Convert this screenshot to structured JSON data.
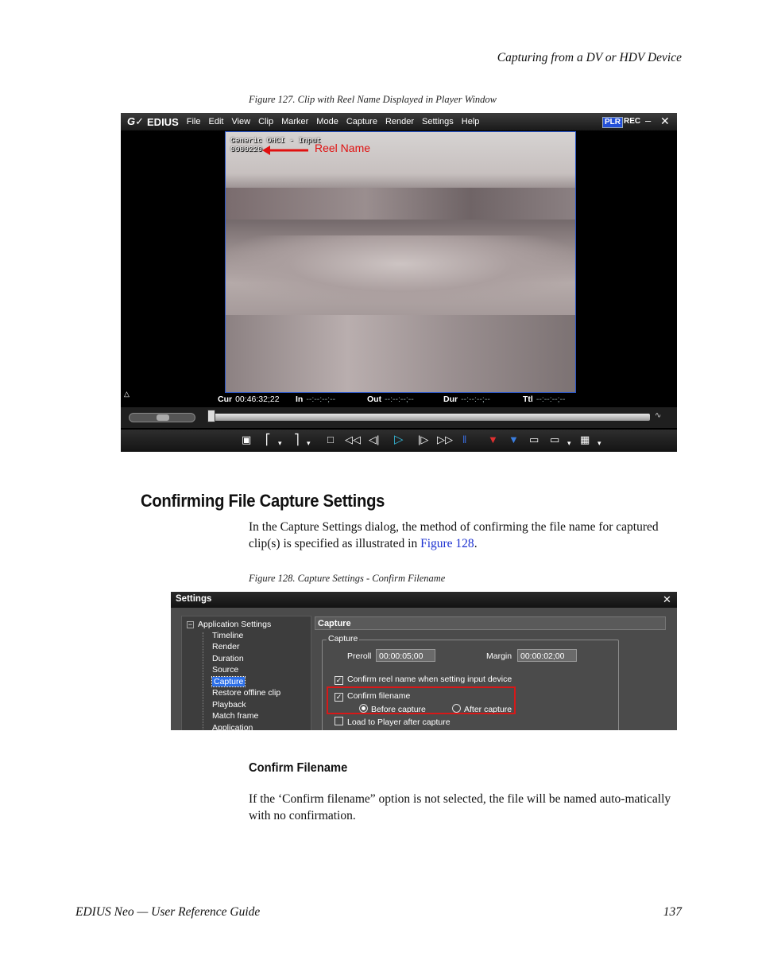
{
  "page": {
    "running_head": "Capturing from a DV or HDV Device",
    "section_title": "Confirming File Capture Settings",
    "intro_before_link": "In the Capture Settings dialog, the method of confirming the file name for captured clip(s) is specified as illustrated in ",
    "intro_link": "Figure 128",
    "intro_after_link": ".",
    "subsection_title": "Confirm Filename",
    "body_text": "If the ‘Confirm filename” option is not selected, the file will be named auto-matically with no confirmation.",
    "footer_left": "EDIUS Neo  —  User Reference Guide",
    "page_number": "137"
  },
  "figure127": {
    "caption": "Figure 127.  Clip with Reel Name Displayed in Player Window",
    "logo": "G✓",
    "brand": "EDIUS",
    "menu": [
      "File",
      "Edit",
      "View",
      "Clip",
      "Marker",
      "Mode",
      "Capture",
      "Render",
      "Settings",
      "Help"
    ],
    "plr": "PLR",
    "rec": "REC",
    "min_icon": "–",
    "close_icon": "✕",
    "overlay_line1": "Generic OHCI - Input",
    "overlay_line2": "0000220",
    "callout": "Reel Name",
    "timecode": {
      "cur_label": "Cur",
      "cur_value": "00:46:32;22",
      "in_label": "In",
      "in_value": "--:--:--;--",
      "out_label": "Out",
      "out_value": "--:--:--;--",
      "dur_label": "Dur",
      "dur_value": "--:--:--;--",
      "ttl_label": "Ttl",
      "ttl_value": "--:--:--;--"
    }
  },
  "figure128": {
    "caption": "Figure 128.  Capture Settings - Confirm Filename",
    "title": "Settings",
    "close_icon": "✕",
    "tree_root": "Application Settings",
    "tree_items": [
      "Timeline",
      "Render",
      "Duration",
      "Source",
      "Capture",
      "Restore offline clip",
      "Playback",
      "Match frame",
      "Application"
    ],
    "panel_title": "Capture",
    "group_label": "Capture",
    "preroll_label": "Preroll",
    "preroll_value": "00:00:05;00",
    "margin_label": "Margin",
    "margin_value": "00:00:02;00",
    "confirm_reel": "Confirm reel name when setting input device",
    "confirm_filename": "Confirm filename",
    "before_capture": "Before capture",
    "after_capture": "After capture",
    "load_to_player": "Load to Player after capture",
    "check_mark": "✓"
  }
}
